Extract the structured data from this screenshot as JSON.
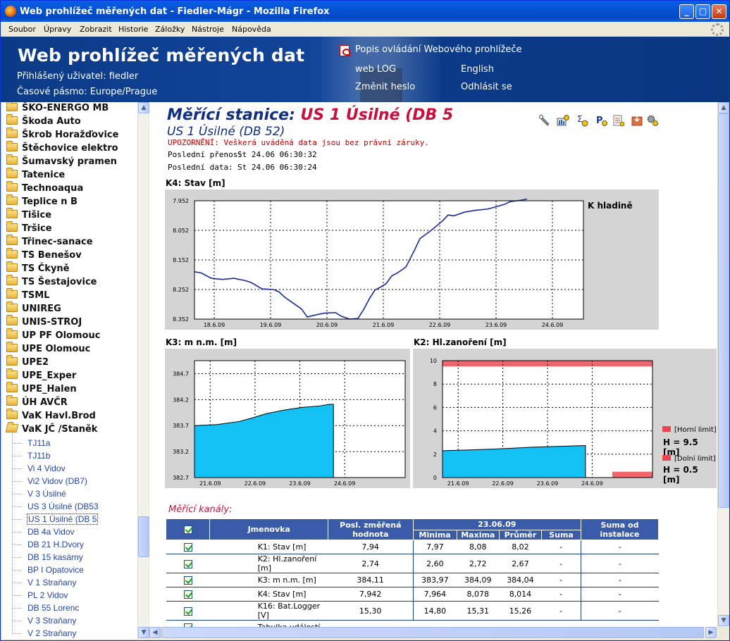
{
  "window": {
    "title": "Web prohlížeč měřených dat - Fiedler-Mágr - Mozilla Firefox"
  },
  "menu": [
    "Soubor",
    "Úpravy",
    "Zobrazit",
    "Historie",
    "Záložky",
    "Nástroje",
    "Nápověda"
  ],
  "header": {
    "app_title": "Web prohlížeč měřených dat",
    "user": "Přihlášený uživatel: fiedler",
    "timezone": "Časové pásmo: Europe/Prague",
    "help_link": "Popis ovládání Webového prohlížeče",
    "weblog": "web LOG",
    "english": "English",
    "change_password": "Změnit heslo",
    "logout": "Odhlásit se"
  },
  "tree": {
    "folders": [
      "ŠKO-ENERGO MB",
      "Škoda Auto",
      "Škrob Horažďovice",
      "Štěchovice elektro",
      "Šumavský pramen",
      "Tatenice",
      "Technoaqua",
      "Teplice n B",
      "Tišice",
      "Tršice",
      "Třinec-sanace",
      "TS Benešov",
      "TS Čkyně",
      "TS Šestajovice",
      "TSML",
      "UNIREG",
      "UNIS-STROJ",
      "UP PF Olomouc",
      "UPE Olomouc",
      "UPE2",
      "UPE_Exper",
      "UPE_Halen",
      "ÚH AVČR",
      "VaK Havl.Brod",
      "VaK JČ /Staněk"
    ],
    "stations": [
      "TJ11a",
      "TJ11b",
      "Vi 4 Vidov",
      "Vi2 Vidov (DB7)",
      "V 3 Úsilné",
      "US 3 Úsilné (DB53",
      "US 1 Úsilné (DB 5",
      "DB 4a Vidov",
      "DB 21 H.Dvory",
      "DB 15 kasárny",
      "BP I Opatovice",
      "V 1 Straňany",
      "PL 2 Vidov",
      "DB 55 Lorenc",
      "V 3 Straňany",
      "V 2 Straňany"
    ],
    "selected_station": "US 1 Úsilné (DB 5"
  },
  "station": {
    "title_prefix": "Měřící stanice:",
    "title_name": "US 1 Úsilné (DB 5",
    "subtitle": "US 1 Úsilné (DB 52)",
    "warning": "UPOZORNĚNÍ: Veškerá uváděná data jsou bez právní záruky.",
    "last_transfer_label": "Poslední přenos:",
    "last_transfer": "St 24.06 06:30:32",
    "last_data_label": "Poslední data:",
    "last_data": "St 24.06 06:30:24"
  },
  "toolbar_icons": [
    "wrench-icon",
    "chart-settings-icon",
    "sum-icon",
    "parameter-icon",
    "report-icon",
    "export-icon",
    "gears-icon"
  ],
  "charts": {
    "k4": {
      "title": "K4: Stav [m]",
      "side_label": "K hladině"
    },
    "k3": {
      "title": "K3:  m n.m. [m]"
    },
    "k2": {
      "title": "K2: Hl.zanoření [m]",
      "legend_upper": "[Horní limit]",
      "upper_value": "H = 9.5 [m]",
      "legend_lower": "[Dolní limit]",
      "lower_value": "H = 0.5 [m]"
    }
  },
  "chart_data": [
    {
      "type": "line",
      "title": "K4: Stav [m]",
      "x_ticks": [
        "18.6.09",
        "19.6.09",
        "20.6.09",
        "21.6.09",
        "22.6.09",
        "23.6.09",
        "24.6.09"
      ],
      "y_ticks": [
        "7.952",
        "8.052",
        "8.152",
        "8.252",
        "8.352"
      ],
      "ylim": [
        7.952,
        8.352
      ],
      "y_inverted": true,
      "color": "#1A2A9A",
      "x": [
        0,
        0.12,
        0.3,
        0.5,
        0.7,
        0.9,
        1.0,
        1.2,
        1.4,
        1.5,
        1.6,
        1.75,
        1.9,
        2.0,
        2.1,
        2.3,
        2.5,
        2.6,
        2.75,
        2.9,
        3.0,
        3.1,
        3.2,
        3.3,
        3.4,
        3.5,
        3.6,
        3.75,
        3.9,
        4.0,
        4.2,
        4.4,
        4.5,
        4.6,
        4.8,
        5.0,
        5.2,
        5.3,
        5.5,
        5.6,
        5.8,
        5.9
      ],
      "values": [
        8.192,
        8.196,
        8.214,
        8.218,
        8.214,
        8.222,
        8.228,
        8.25,
        8.252,
        8.26,
        8.278,
        8.298,
        8.318,
        8.345,
        8.34,
        8.332,
        8.33,
        8.342,
        8.352,
        8.35,
        8.32,
        8.284,
        8.254,
        8.244,
        8.232,
        8.206,
        8.196,
        8.176,
        8.12,
        8.08,
        8.052,
        8.02,
        8.0,
        8.003,
        7.99,
        7.984,
        7.98,
        7.975,
        7.964,
        7.955,
        7.95,
        7.946
      ]
    },
    {
      "type": "area",
      "title": "K3:  m n.m. [m]",
      "x_ticks": [
        "21.6.09",
        "22.6.09",
        "23.6.09",
        "24.6.09"
      ],
      "y_ticks": [
        "384.7",
        "384.2",
        "383.7",
        "383.2",
        "382.7"
      ],
      "ylim": [
        382.7,
        384.95
      ],
      "color": "#13C1F5",
      "x": [
        0,
        0.5,
        1.0,
        1.3,
        1.6,
        2.0,
        2.4,
        2.8,
        3.0,
        3.1
      ],
      "values": [
        383.7,
        383.72,
        383.78,
        383.85,
        383.93,
        384.0,
        384.05,
        384.08,
        384.11,
        384.11
      ]
    },
    {
      "type": "area",
      "title": "K2: Hl.zanoření [m]",
      "x_ticks": [
        "21.6.09",
        "22.6.09",
        "23.6.09",
        "24.6.09"
      ],
      "y_ticks": [
        "10",
        "8",
        "6",
        "4",
        "2",
        "0"
      ],
      "ylim": [
        0,
        10
      ],
      "color": "#13C1F5",
      "x": [
        0,
        0.5,
        1.0,
        1.5,
        2.0,
        2.5,
        3.0,
        3.2
      ],
      "values": [
        2.3,
        2.35,
        2.42,
        2.5,
        2.6,
        2.66,
        2.72,
        2.74
      ],
      "upper_limit": 9.5,
      "lower_limit": 0.5,
      "limit_color": "#F0646B"
    }
  ],
  "channels": {
    "section_title": "Měřící kanály:",
    "headers": {
      "name": "Jmenovka",
      "last": "Posl. změřená hodnota",
      "date": "23.06.09",
      "min": "Minima",
      "max": "Maxima",
      "avg": "Průměr",
      "sum": "Suma",
      "sum_install": "Suma od instalace"
    },
    "rows": [
      {
        "name": "K1: Stav [m]",
        "last": "7,94",
        "min": "7,97",
        "max": "8,08",
        "avg": "8,02",
        "sum": "-",
        "sum_install": "-"
      },
      {
        "name": "K2: Hl.zanoření [m]",
        "last": "2,74",
        "min": "2,60",
        "max": "2,72",
        "avg": "2,67",
        "sum": "-",
        "sum_install": "-"
      },
      {
        "name": "K3: m n.m. [m]",
        "last": "384,11",
        "min": "383,97",
        "max": "384,09",
        "avg": "384,04",
        "sum": "-",
        "sum_install": "-"
      },
      {
        "name": "K4: Stav [m]",
        "last": "7,942",
        "min": "7,964",
        "max": "8,078",
        "avg": "8,014",
        "sum": "-",
        "sum_install": "-"
      },
      {
        "name": "K16: Bat.Logger [V]",
        "last": "15,30",
        "min": "14,80",
        "max": "15,31",
        "avg": "15,26",
        "sum": "-",
        "sum_install": "-"
      }
    ],
    "events_table": "Tabulka událostí"
  }
}
